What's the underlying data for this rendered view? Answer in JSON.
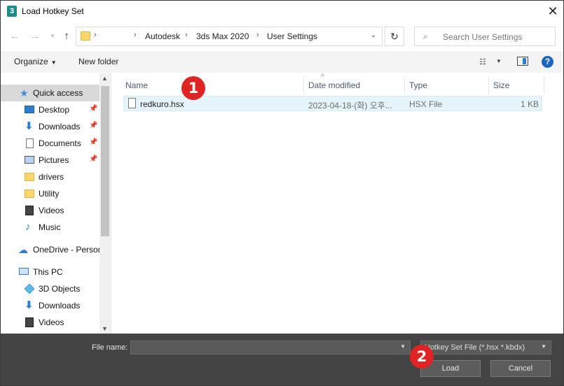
{
  "window": {
    "title": "Load Hotkey Set",
    "app_icon_text": "3"
  },
  "nav": {
    "breadcrumbs": [
      "Autodesk",
      "3ds Max 2020",
      "User Settings"
    ],
    "search_placeholder": "Search User Settings"
  },
  "toolbar": {
    "organize": "Organize",
    "new_folder": "New folder"
  },
  "sidebar": {
    "items": [
      {
        "label": "Quick access",
        "icon": "star-icon",
        "pinned": false,
        "selected": true
      },
      {
        "label": "Desktop",
        "icon": "desktop-icon",
        "pinned": true
      },
      {
        "label": "Downloads",
        "icon": "download-icon",
        "pinned": true
      },
      {
        "label": "Documents",
        "icon": "document-icon",
        "pinned": true
      },
      {
        "label": "Pictures",
        "icon": "pictures-icon",
        "pinned": true
      },
      {
        "label": "drivers",
        "icon": "folder-icon",
        "pinned": false
      },
      {
        "label": "Utility",
        "icon": "folder-icon",
        "pinned": false
      },
      {
        "label": "Videos",
        "icon": "video-icon",
        "pinned": false
      },
      {
        "label": "Music",
        "icon": "music-icon",
        "pinned": false
      },
      {
        "label": "OneDrive - Person",
        "icon": "onedrive-icon",
        "pinned": false
      },
      {
        "label": "This PC",
        "icon": "pc-icon",
        "pinned": false
      },
      {
        "label": "3D Objects",
        "icon": "3d-objects-icon",
        "pinned": false
      },
      {
        "label": "Downloads",
        "icon": "download-icon",
        "pinned": false
      },
      {
        "label": "Videos",
        "icon": "video-icon",
        "pinned": false
      }
    ]
  },
  "columns": {
    "name": "Name",
    "date": "Date modified",
    "type": "Type",
    "size": "Size"
  },
  "files": [
    {
      "name": "redkuro.hsx",
      "date": "2023-04-18-(화) 오후...",
      "type": "HSX File",
      "size": "1 KB"
    }
  ],
  "footer": {
    "file_name_label": "File name:",
    "file_name_value": "",
    "filter": "Hotkey Set File (*.hsx *.kbdx)",
    "load": "Load",
    "cancel": "Cancel"
  },
  "markers": {
    "one": "1",
    "two": "2"
  },
  "colors": {
    "accent": "#2d7dd2",
    "marker": "#e02424",
    "footer_bg": "#444444",
    "selection": "#e5f3fb"
  }
}
